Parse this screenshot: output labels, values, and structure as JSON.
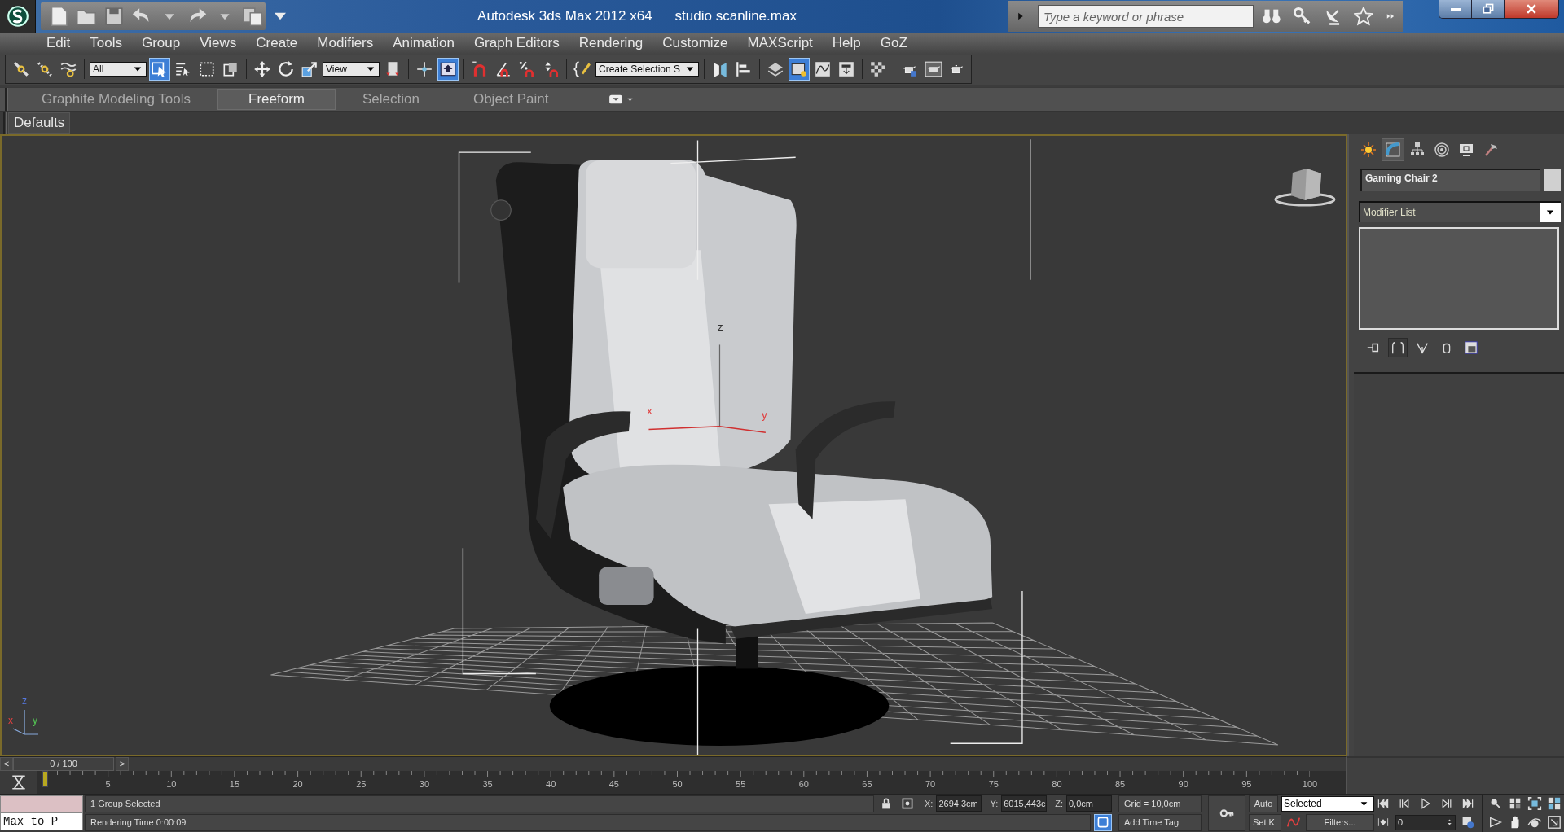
{
  "title_bar": {
    "title": "Autodesk 3ds Max  2012 x64",
    "file": "studio scanline.max",
    "search": {
      "placeholder": "Type a keyword or phrase"
    }
  },
  "menu": [
    "Edit",
    "Tools",
    "Group",
    "Views",
    "Create",
    "Modifiers",
    "Animation",
    "Graph Editors",
    "Rendering",
    "Customize",
    "MAXScript",
    "Help",
    "GoZ"
  ],
  "main_toolbar": {
    "groups": [
      [
        {
          "kind": "link",
          "selected": false
        },
        {
          "kind": "unlink",
          "selected": false
        },
        {
          "kind": "bind",
          "selected": false
        }
      ],
      [
        {
          "kind": "dropdown",
          "value": "All"
        },
        {
          "kind": "select",
          "selected": true
        },
        {
          "kind": "select-name",
          "selected": false
        },
        {
          "kind": "region",
          "selected": false
        },
        {
          "kind": "crossing",
          "selected": false
        }
      ],
      [
        {
          "kind": "move",
          "selected": false
        },
        {
          "kind": "rotate",
          "selected": false
        },
        {
          "kind": "scale",
          "selected": false
        },
        {
          "kind": "dropdown",
          "value": "View"
        },
        {
          "kind": "pivot",
          "selected": false
        }
      ],
      [
        {
          "kind": "manipulate",
          "selected": false
        },
        {
          "kind": "keyboard",
          "selected": true
        }
      ],
      [
        {
          "kind": "snap",
          "selected": false
        },
        {
          "kind": "angle-snap",
          "selected": false
        },
        {
          "kind": "percent-snap",
          "selected": false
        },
        {
          "kind": "spinner-snap",
          "selected": false
        }
      ],
      [
        {
          "kind": "named-edit",
          "selected": false
        },
        {
          "kind": "dropdown",
          "value": "Create Selection S"
        }
      ],
      [
        {
          "kind": "mirror",
          "selected": false
        },
        {
          "kind": "align",
          "selected": false
        }
      ],
      [
        {
          "kind": "layer",
          "selected": false
        },
        {
          "kind": "ribbon",
          "selected": true
        },
        {
          "kind": "curve",
          "selected": false
        },
        {
          "kind": "schematic",
          "selected": false
        }
      ],
      [
        {
          "kind": "material"
        }
      ],
      [
        {
          "kind": "render-setup",
          "selected": false
        },
        {
          "kind": "frame-window",
          "selected": false
        },
        {
          "kind": "render",
          "selected": false
        }
      ]
    ]
  },
  "ribbon_tabs": [
    {
      "label": "Graphite Modeling Tools",
      "selected": false
    },
    {
      "label": "Freeform",
      "selected": true
    },
    {
      "label": "Selection",
      "selected": false
    },
    {
      "label": "Object Paint",
      "selected": false
    }
  ],
  "ribbon_panel": {
    "label": "Defaults"
  },
  "viewport": {
    "gizmo_labels": [
      "z",
      "x",
      "y"
    ],
    "corner_axis_labels": [
      "z",
      "x",
      "y"
    ]
  },
  "command_panel": {
    "tabs": [
      {
        "kind": "create",
        "selected": false
      },
      {
        "kind": "modify",
        "selected": true
      },
      {
        "kind": "hierarchy",
        "selected": false
      },
      {
        "kind": "motion",
        "selected": false
      },
      {
        "kind": "display",
        "selected": false
      },
      {
        "kind": "utilities",
        "selected": false
      }
    ],
    "object_name": "Gaming Chair 2",
    "modifier_list": "Modifier List"
  },
  "time_slider": {
    "prev": "<",
    "label": "0 / 100",
    "next": ">",
    "level": 0
  },
  "track_bar": {
    "labels": [
      "5",
      "10",
      "15",
      "20",
      "25",
      "30",
      "35",
      "40",
      "45",
      "50",
      "55",
      "60",
      "65",
      "70",
      "75",
      "80",
      "85",
      "90",
      "95",
      "100"
    ]
  },
  "status": {
    "listener_input": "Max to P",
    "selection": "1 Group Selected",
    "prompt": "Rendering Time  0:00:09",
    "x_label": "X:",
    "x": "2694,3cm",
    "y_label": "Y:",
    "y": "6015,443c",
    "z_label": "Z:",
    "z": "0,0cm",
    "grid": "Grid = 10,0cm",
    "add_time_tag": "Add Time Tag",
    "auto_key": "Auto",
    "set_key": "Set K.",
    "key_filter": "Selected",
    "filters": "Filters...",
    "frame": "0"
  }
}
